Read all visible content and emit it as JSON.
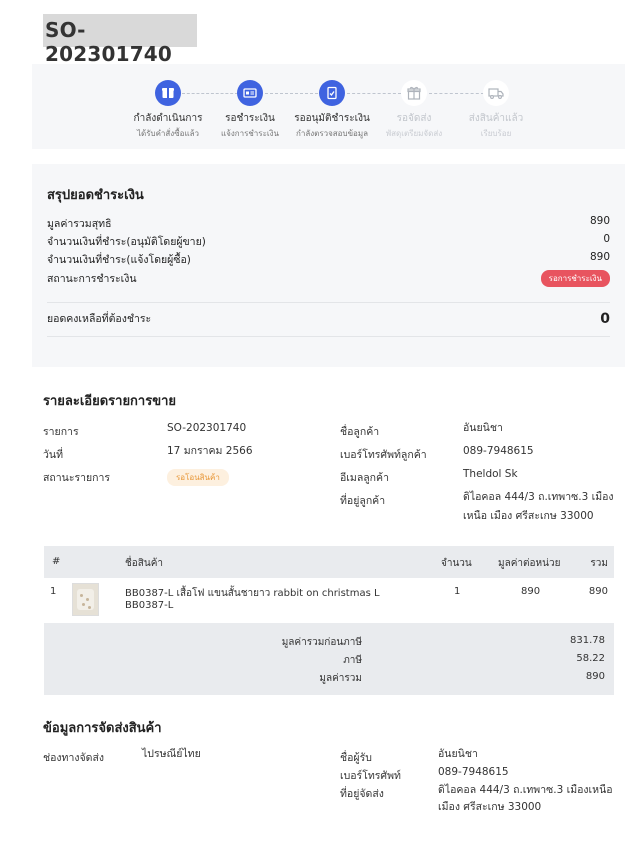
{
  "order": {
    "title": "SO-202301740"
  },
  "progress": {
    "steps": [
      {
        "label": "กำลังดำเนินการ",
        "sublabel": "ได้รับคำสั่งซื้อแล้ว",
        "icon": "box-icon",
        "active": true
      },
      {
        "label": "รอชำระเงิน",
        "sublabel": "แจ้งการชำระเงิน",
        "icon": "payment-card-icon",
        "active": true
      },
      {
        "label": "รออนุมัติชำระเงิน",
        "sublabel": "กำลังตรวจสอบข้อมูล",
        "icon": "document-check-icon",
        "active": true
      },
      {
        "label": "รอจัดส่ง",
        "sublabel": "พัสดุเตรียมจัดส่ง",
        "icon": "gift-box-icon",
        "active": false
      },
      {
        "label": "ส่งสินค้าแล้ว",
        "sublabel": "เรียบร้อย",
        "icon": "truck-icon",
        "active": false
      }
    ],
    "colors": {
      "active": "#3f63e0",
      "inactive": "#c2c6cc"
    }
  },
  "payment_summary": {
    "heading": "สรุปยอดชำระเงิน",
    "net_total_label": "มูลค่ารวมสุทธิ",
    "net_total_value": "890",
    "paid_approved_label": "จำนวนเงินที่ชำระ(อนุมัติโดยผู้ขาย)",
    "paid_approved_value": "0",
    "paid_notified_label": "จำนวนเงินที่ชำระ(แจ้งโดยผู้ซื้อ)",
    "paid_notified_value": "890",
    "status_label": "สถานะการชำระเงิน",
    "status_value": "รอการชำระเงิน",
    "status_color": "#e8545f",
    "balance_label": "ยอดคงเหลือที่ต้องชำระ",
    "balance_value": "0"
  },
  "sale_details": {
    "heading": "รายละเอียดรายการขาย",
    "item_label": "รายการ",
    "item_value": "SO-202301740",
    "date_label": "วันที่",
    "date_value": "17 มกราคม 2566",
    "status_label": "สถานะรายการ",
    "status_value": "รอโอนสินค้า",
    "customer_name_label": "ชื่อลูกค้า",
    "customer_name_value": "อันยนิชา",
    "customer_phone_label": "เบอร์โทรศัพท์ลูกค้า",
    "customer_phone_value": "089-7948615",
    "customer_email_label": "อีเมลลูกค้า",
    "customer_email_value": "Theldol Sk",
    "customer_address_label": "ที่อยู่ลูกค้า",
    "customer_address_line1": "ดิไอคอล 444/3 ถ.เทพาซ.3 เมือง",
    "customer_address_line2": "เหนือ เมือง ศรีสะเกษ 33000"
  },
  "items_table": {
    "headers": {
      "index": "#",
      "name": "ชื่อสินค้า",
      "qty": "จำนวน",
      "unit_price": "มูลค่าต่อหน่วย",
      "total": "รวม"
    },
    "rows": [
      {
        "index": "1",
        "name_line1": "BB0387-L เสื้อโฟ แขนสั้นชายาว rabbit on christmas L",
        "name_line2": "BB0387-L",
        "qty": "1",
        "unit_price": "890",
        "total": "890"
      }
    ],
    "subtotal_label": "มูลค่ารวมก่อนภาษี",
    "subtotal_value": "831.78",
    "tax_label": "ภาษี",
    "tax_value": "58.22",
    "grand_total_label": "มูลค่ารวม",
    "grand_total_value": "890"
  },
  "shipping": {
    "heading": "ข้อมูลการจัดส่งสินค้า",
    "channel_label": "ช่องทางจัดส่ง",
    "channel_value": "ไปรษณีย์ไทย",
    "recipient_label": "ชื่อผู้รับ",
    "recipient_value": "อันยนิชา",
    "phone_label": "เบอร์โทรศัพท์",
    "phone_value": "089-7948615",
    "address_label": "ที่อยู่จัดส่ง",
    "address_line1": "ดิไอคอล 444/3 ถ.เทพาซ.3 เมืองเหนือ",
    "address_line2": "เมือง ศรีสะเกษ 33000"
  }
}
